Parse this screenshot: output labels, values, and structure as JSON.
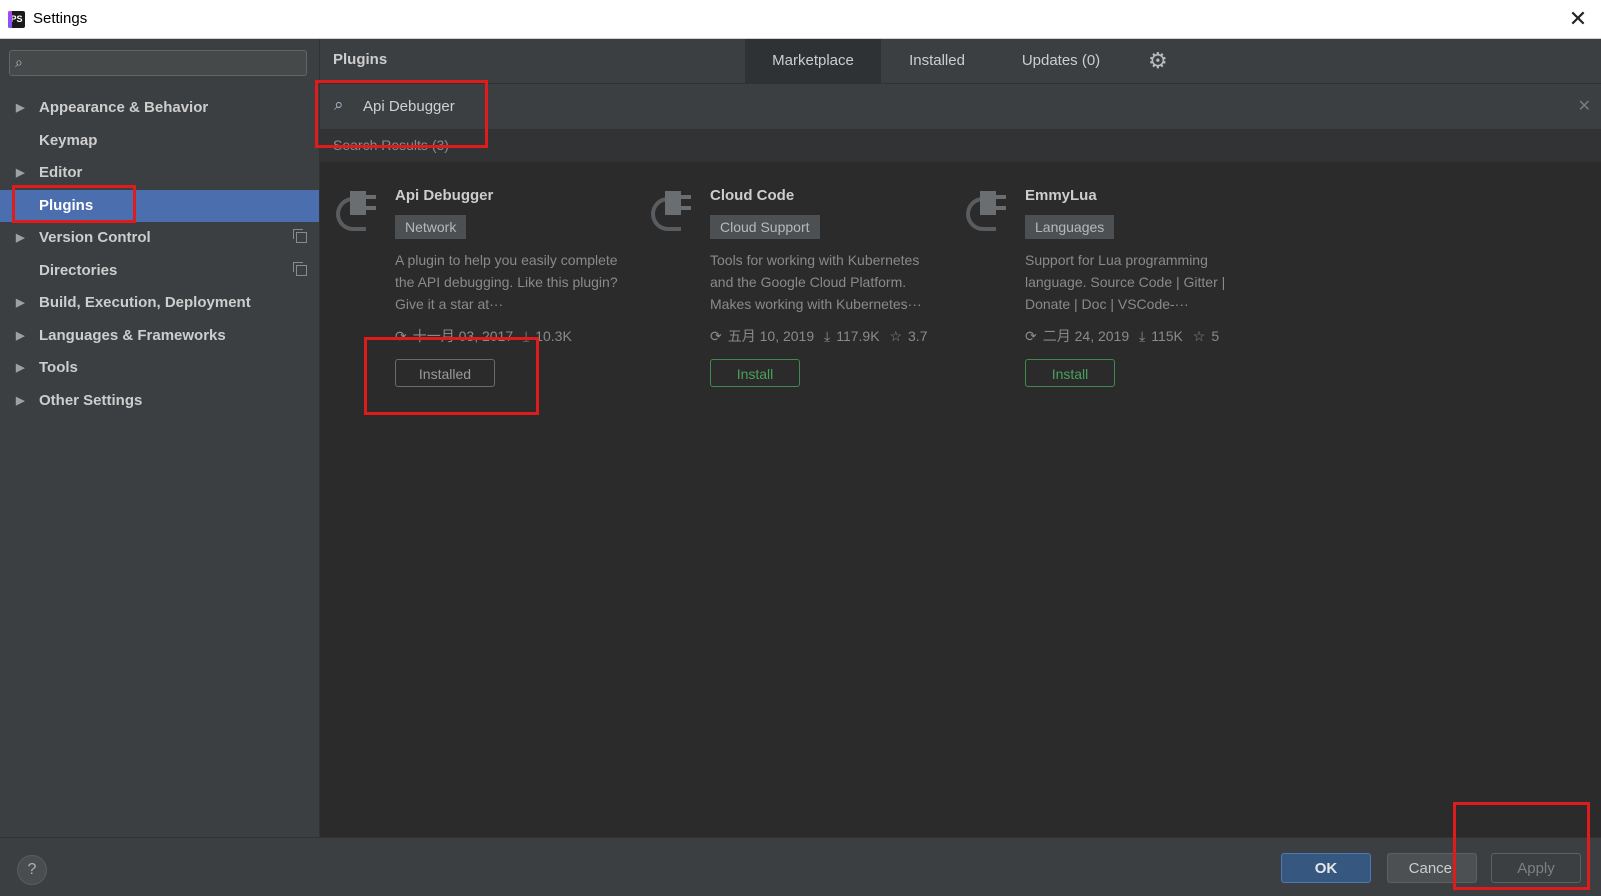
{
  "window": {
    "title": "Settings",
    "app_icon": "PS"
  },
  "sidebar": {
    "search_placeholder": "",
    "items": [
      {
        "label": "Appearance & Behavior",
        "expandable": true
      },
      {
        "label": "Keymap",
        "expandable": false
      },
      {
        "label": "Editor",
        "expandable": true
      },
      {
        "label": "Plugins",
        "expandable": false,
        "selected": true
      },
      {
        "label": "Version Control",
        "expandable": true,
        "project_icon": true
      },
      {
        "label": "Directories",
        "expandable": false,
        "project_icon": true
      },
      {
        "label": "Build, Execution, Deployment",
        "expandable": true
      },
      {
        "label": "Languages & Frameworks",
        "expandable": true
      },
      {
        "label": "Tools",
        "expandable": true
      },
      {
        "label": "Other Settings",
        "expandable": true
      }
    ]
  },
  "plugins": {
    "title": "Plugins",
    "tabs": [
      "Marketplace",
      "Installed",
      "Updates (0)"
    ],
    "active_tab": "Marketplace",
    "search_value": "Api Debugger",
    "results_label": "Search Results (3)",
    "cards": [
      {
        "name": "Api Debugger",
        "tag": "Network",
        "desc": "A plugin to help you easily complete the API debugging. Like this plugin? Give it a star at···",
        "date": "十一月 03, 2017",
        "downloads": "10.3K",
        "rating": "",
        "button": "Installed",
        "installed": true
      },
      {
        "name": "Cloud Code",
        "tag": "Cloud Support",
        "desc": "Tools for working with Kubernetes and the Google Cloud Platform. Makes working with Kubernetes···",
        "date": "五月 10, 2019",
        "downloads": "117.9K",
        "rating": "3.7",
        "button": "Install",
        "installed": false
      },
      {
        "name": "EmmyLua",
        "tag": "Languages",
        "desc": "Support for Lua programming language. Source Code | Gitter | Donate | Doc | VSCode-···",
        "date": "二月 24, 2019",
        "downloads": "115K",
        "rating": "5",
        "button": "Install",
        "installed": false
      }
    ]
  },
  "footer": {
    "help": "?",
    "ok": "OK",
    "cancel": "Cancel",
    "apply": "Apply"
  },
  "colors": {
    "selection": "#4b6eaf",
    "highlight": "#e01b1b",
    "install_green": "#4aa05a",
    "ok_blue": "#365880"
  }
}
